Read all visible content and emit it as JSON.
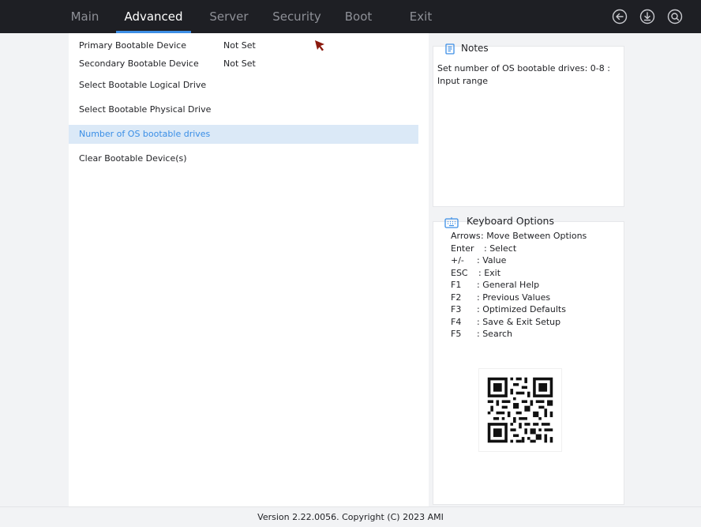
{
  "tabs": [
    {
      "label": "Main"
    },
    {
      "label": "Advanced"
    },
    {
      "label": "Server"
    },
    {
      "label": "Security"
    },
    {
      "label": "Boot"
    },
    {
      "label": "Exit"
    }
  ],
  "active_tab": "Advanced",
  "top_icons": [
    "back-icon",
    "save-download-icon",
    "search-icon"
  ],
  "options": [
    {
      "label": "Primary Bootable Device",
      "value": "Not Set"
    },
    {
      "label": "Secondary Bootable Device",
      "value": "Not Set"
    },
    {
      "label": "Select Bootable Logical Drive",
      "value": ""
    },
    {
      "label": "Select Bootable Physical Drive",
      "value": ""
    },
    {
      "label": "Number of OS bootable drives",
      "value": ""
    },
    {
      "label": "Clear Bootable Device(s)",
      "value": ""
    }
  ],
  "selected_option": "Number of OS bootable drives",
  "notes": {
    "title": "Notes",
    "text": "Set number of OS bootable drives: 0-8 : Input range"
  },
  "keyboard": {
    "title": "Keyboard Options",
    "items": [
      {
        "key": "Arrows",
        "desc": ": Move Between Options"
      },
      {
        "key": "Enter",
        "desc": ": Select"
      },
      {
        "key": "+/-",
        "desc": ": Value"
      },
      {
        "key": "ESC",
        "desc": ": Exit"
      },
      {
        "key": "F1",
        "desc": ": General Help"
      },
      {
        "key": "F2",
        "desc": ": Previous Values"
      },
      {
        "key": "F3",
        "desc": ": Optimized Defaults"
      },
      {
        "key": "F4",
        "desc": ": Save & Exit Setup"
      },
      {
        "key": "F5",
        "desc": ": Search"
      }
    ]
  },
  "footer": "Version 2.22.0056. Copyright (C) 2023 AMI",
  "colors": {
    "topbar": "#1e1f24",
    "accent": "#3d8fe6",
    "selected_bg": "#dbe9f7",
    "selected_text": "#3a8ee6",
    "cursor": "#8b1a0e"
  }
}
